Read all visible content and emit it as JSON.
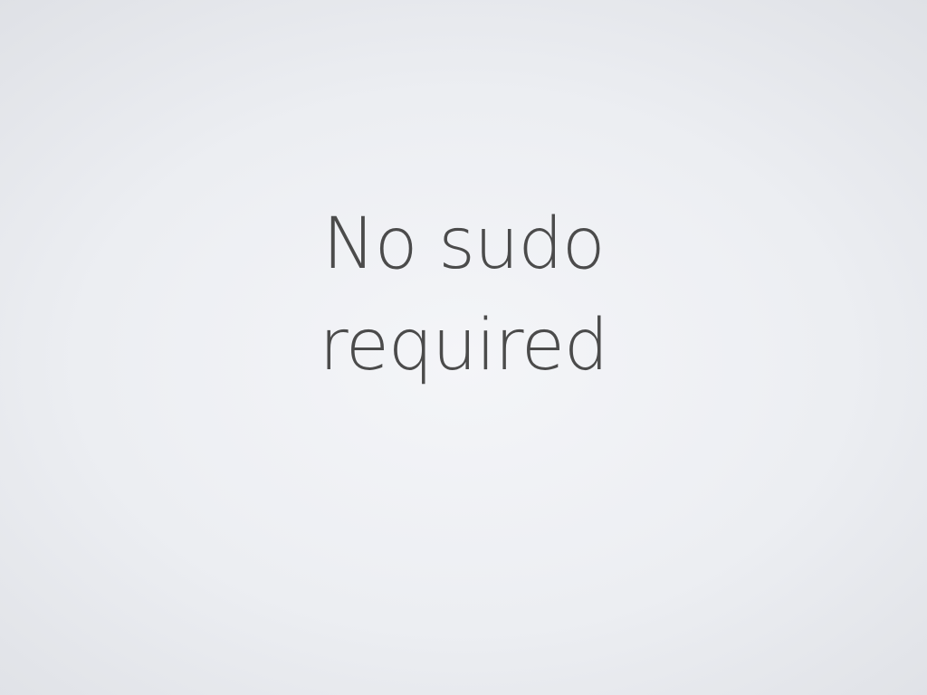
{
  "slide": {
    "title_lines": [
      "No sudo",
      "required"
    ],
    "background_color": "#eceef2",
    "text_color": "#4b4b4b"
  }
}
